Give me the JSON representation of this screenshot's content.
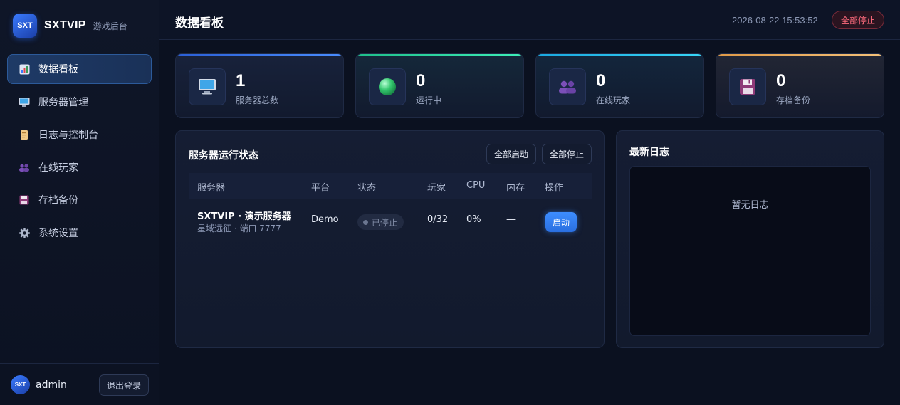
{
  "brand": {
    "logo_text": "SXT",
    "name": "SXTVIP",
    "subtitle": "游戏后台"
  },
  "sidebar": {
    "items": [
      {
        "label": "数据看板",
        "icon": "bar-chart-icon",
        "active": true
      },
      {
        "label": "服务器管理",
        "icon": "monitor-icon",
        "active": false
      },
      {
        "label": "日志与控制台",
        "icon": "scroll-icon",
        "active": false
      },
      {
        "label": "在线玩家",
        "icon": "users-icon",
        "active": false
      },
      {
        "label": "存档备份",
        "icon": "floppy-disk-icon",
        "active": false
      },
      {
        "label": "系统设置",
        "icon": "gear-icon",
        "active": false
      }
    ],
    "user": {
      "avatar_text": "SXT",
      "name": "admin",
      "logout_label": "退出登录"
    }
  },
  "header": {
    "title": "数据看板",
    "datetime": "2026-08-22 15:53:52",
    "stop_all_label": "全部停止"
  },
  "stats": [
    {
      "value": "1",
      "label": "服务器总数",
      "icon": "monitor-icon",
      "accent": "#3a7bff"
    },
    {
      "value": "0",
      "label": "运行中",
      "icon": "green-orb-icon",
      "accent": "#2ee6a6"
    },
    {
      "value": "0",
      "label": "在线玩家",
      "icon": "users-icon",
      "accent": "#22c7f0"
    },
    {
      "value": "0",
      "label": "存档备份",
      "icon": "floppy-disk-icon",
      "accent": "#f0b060"
    }
  ],
  "servers_panel": {
    "title": "服务器运行状态",
    "start_all_label": "全部启动",
    "stop_all_label": "全部停止",
    "columns": [
      "服务器",
      "平台",
      "状态",
      "玩家",
      "CPU",
      "内存",
      "操作"
    ],
    "rows": [
      {
        "name": "SXTVIP · 演示服务器",
        "sub": "星域远征 · 端口 7777",
        "platform": "Demo",
        "status": "已停止",
        "players": "0/32",
        "cpu": "0%",
        "memory": "—",
        "action": "启动"
      }
    ]
  },
  "logs_panel": {
    "title": "最新日志",
    "empty_text": "暂无日志"
  }
}
